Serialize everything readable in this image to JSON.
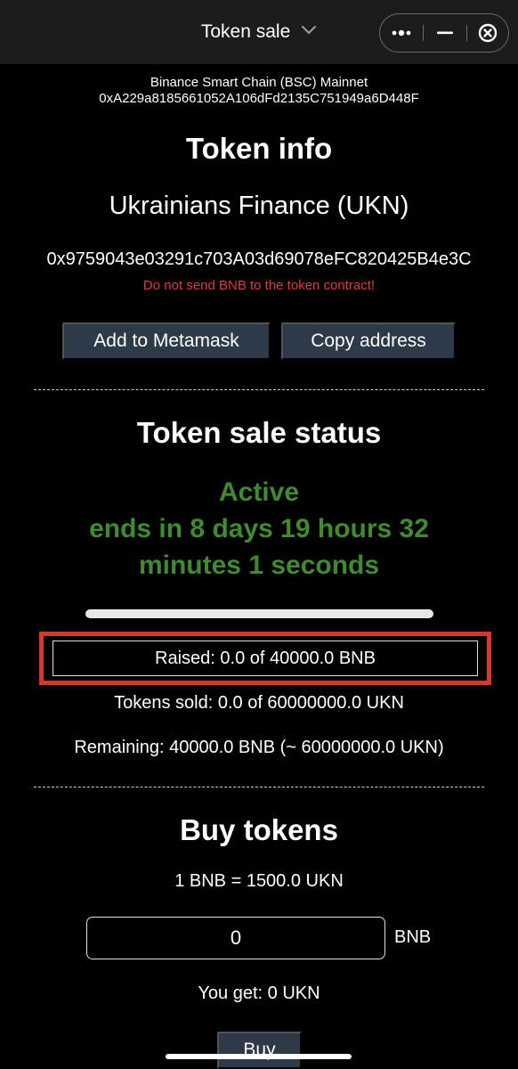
{
  "header": {
    "title": "Token sale"
  },
  "network": {
    "name": "Binance Smart Chain (BSC) Mainnet",
    "sale_address": "0xA229a8185661052A106dFd2135C751949a6D448F"
  },
  "token_info": {
    "heading": "Token info",
    "name": "Ukrainians Finance (UKN)",
    "contract": "0x9759043e03291c703A03d69078eFC820425B4e3C",
    "warning": "Do not send BNB to the token contract!",
    "add_button": "Add to Metamask",
    "copy_button": "Copy address"
  },
  "sale_status": {
    "heading": "Token sale status",
    "state": "Active",
    "countdown_line1": "ends in 8 days 19 hours 32",
    "countdown_line2": "minutes 1 seconds",
    "progress_fraction": 0.0,
    "raised": "Raised: 0.0 of 40000.0 BNB",
    "tokens_sold": "Tokens sold: 0.0 of 60000000.0 UKN",
    "remaining": "Remaining: 40000.0 BNB (~ 60000000.0 UKN)"
  },
  "buy": {
    "heading": "Buy tokens",
    "rate": "1 BNB = 1500.0 UKN",
    "amount_value": "0",
    "amount_unit": "BNB",
    "you_get": "You get: 0 UKN",
    "buy_button": "Buy"
  },
  "colors": {
    "active": "#3f8b2e",
    "warning": "#e53935",
    "highlight_box": "#d6392b",
    "button_bg": "#2d3a48"
  }
}
